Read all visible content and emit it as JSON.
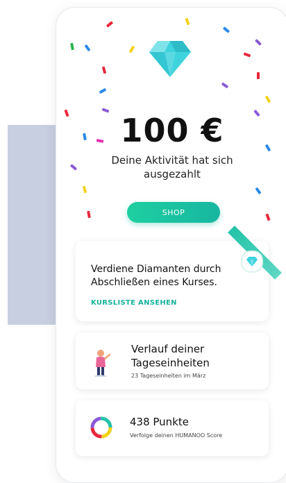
{
  "reward": {
    "amount": "100 €",
    "subtitle": "Deine Aktivität hat sich ausgezahlt",
    "shop_label": "SHOP"
  },
  "courses_card": {
    "text": "Verdiene Diamanten durch Abschließen eines Kurses.",
    "link_label": "KURSLISTE ANSEHEN"
  },
  "progress_card": {
    "title": "Verlauf deiner Tageseinheiten",
    "subtitle": "23 Tageseinheiten im März"
  },
  "score_card": {
    "title": "438 Punkte",
    "subtitle": "Verfolge deinen HUMANOO Score"
  },
  "colors": {
    "accent": "#17b6a0",
    "diamond": "#3fd3de",
    "background_panel": "#c8cfe0"
  },
  "icons": {
    "diamond": "diamond-icon",
    "badge": "diamond-badge-icon",
    "person": "person-icon",
    "score": "score-ring-icon"
  }
}
